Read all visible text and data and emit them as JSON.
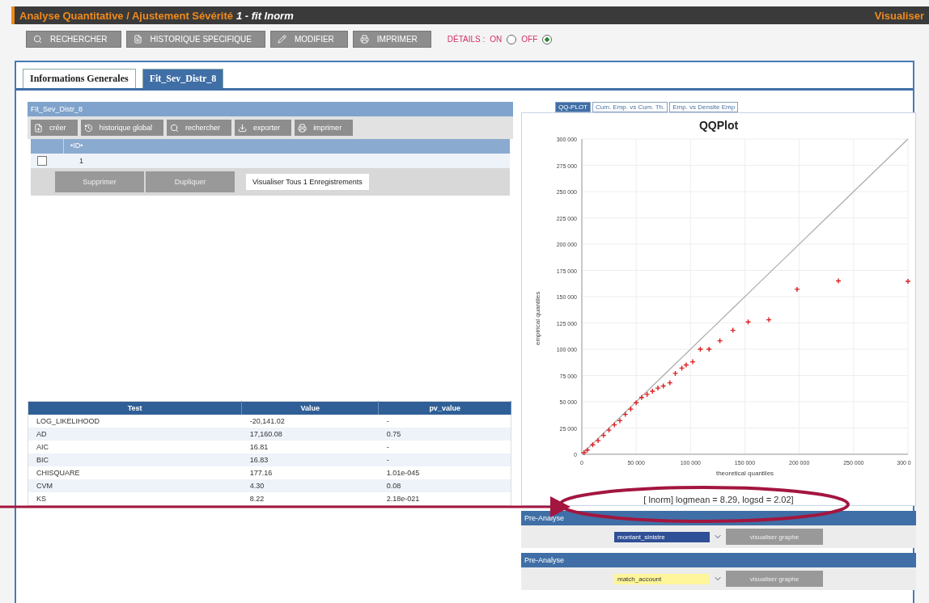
{
  "header": {
    "title": "Analyse Quantitative / Ajustement Sévérité",
    "subtitle": "1 - fit lnorm",
    "action": "Visualiser"
  },
  "toolbar": {
    "buttons": [
      "RECHERCHER",
      "HISTORIQUE SPECIFIQUE",
      "MODIFIER",
      "IMPRIMER"
    ],
    "details_label": "DÉTAILS :",
    "options": [
      {
        "label": "ON",
        "selected": false
      },
      {
        "label": "OFF",
        "selected": true
      }
    ]
  },
  "tabs": [
    {
      "label": "Informations Generales",
      "selected": false
    },
    {
      "label": "Fit_Sev_Distr_8",
      "selected": true
    }
  ],
  "panel": {
    "title": "Fit_Sev_Distr_8",
    "buttons": [
      "créer",
      "historique global",
      "rechercher",
      "exporter",
      "imprimer"
    ],
    "columns": [
      "•ID•"
    ],
    "rows": [
      {
        "checked": false,
        "id": "1"
      }
    ],
    "footer_buttons": [
      "Supprimer",
      "Dupliquer"
    ],
    "count": "Visualiser Tous 1 Enregistrements"
  },
  "stats": {
    "columns": [
      "Test",
      "Value",
      "pv_value"
    ],
    "rows": [
      [
        "LOG_LIKELIHOOD",
        "-20,141.02",
        "-"
      ],
      [
        "AD",
        "17,160.08",
        "0.75"
      ],
      [
        "AIC",
        "16.81",
        "-"
      ],
      [
        "BIC",
        "16.83",
        "-"
      ],
      [
        "CHISQUARE",
        "177.16",
        "1.01e-045"
      ],
      [
        "CVM",
        "4.30",
        "0.08"
      ],
      [
        "KS",
        "8.22",
        "2.18e-021"
      ]
    ]
  },
  "chart_tabs": [
    {
      "label": "QQ-PLOT",
      "selected": true
    },
    {
      "label": "Cum. Emp. vs Cum. Th.",
      "selected": false
    },
    {
      "label": "Emp. vs Densite Emp",
      "selected": false
    }
  ],
  "chart": {
    "chart_data": {
      "type": "scatter",
      "title": "QQPlot",
      "xlabel": "theoretical quantiles",
      "ylabel": "empirical quantiles",
      "x": [
        2000,
        5000,
        10000,
        15000,
        20000,
        25000,
        30000,
        35000,
        40000,
        45000,
        50000,
        55000,
        60000,
        65000,
        70000,
        75000,
        81000,
        86000,
        92000,
        96000,
        102000,
        109000,
        117000,
        127000,
        139000,
        153000,
        172000,
        198000,
        236000,
        300000
      ],
      "grid": true,
      "series": [
        {
          "type": "line",
          "color": "#aaaaaa",
          "values": [
            2000,
            5000,
            10000,
            15000,
            20000,
            25000,
            30000,
            35000,
            40000,
            45000,
            50000,
            55000,
            60000,
            65000,
            70000,
            75000,
            81000,
            86000,
            92000,
            96000,
            102000,
            109000,
            117000,
            127000,
            139000,
            153000,
            172000,
            198000,
            236000,
            300000
          ]
        },
        {
          "color": "#dd2222",
          "values": [
            1500,
            4000,
            9000,
            13000,
            18000,
            23000,
            28000,
            32000,
            38000,
            43000,
            49000,
            54000,
            57000,
            60000,
            63000,
            65000,
            68000,
            77000,
            82000,
            85000,
            88000,
            100000,
            100000,
            108000,
            118000,
            126000,
            128000,
            157000,
            165000,
            164600
          ]
        }
      ],
      "xlim": [
        0,
        300000
      ],
      "ylim": [
        0,
        300000
      ],
      "xticks": [
        0,
        {
          "value": 50000,
          "label": "50 000"
        },
        {
          "value": 100000,
          "label": "100 000"
        },
        {
          "value": 150000,
          "label": "150 000"
        },
        {
          "value": 200000,
          "label": "200 000"
        },
        {
          "value": 250000,
          "label": "250 000"
        },
        {
          "value": 300000,
          "label": "300 0"
        }
      ],
      "yticks": [
        0,
        {
          "value": 25000,
          "label": "25 000"
        },
        {
          "value": 50000,
          "label": "50 000"
        },
        {
          "value": 75000,
          "label": "75 000"
        },
        {
          "value": 100000,
          "label": "100 000"
        },
        {
          "value": 125000,
          "label": "125 000"
        },
        {
          "value": 150000,
          "label": "150 000"
        },
        {
          "value": 175000,
          "label": "175 000"
        },
        {
          "value": 200000,
          "label": "200 000"
        },
        {
          "value": 225000,
          "label": "225 000"
        },
        {
          "value": 250000,
          "label": "250 000"
        },
        {
          "value": 275000,
          "label": "275 000"
        },
        {
          "value": 300000,
          "label": "300 000"
        }
      ]
    },
    "caption": "[ lnorm] logmean = 8.29, logsd = 2.02]"
  },
  "pre_analyses": [
    {
      "title": "Pre-Analyse",
      "select": "montant_sinistre",
      "highlighted": true,
      "button": "visualiser graphe"
    },
    {
      "title": "Pre-Analyse",
      "select": "match_account",
      "highlighted": false,
      "button": "visualiser graphe"
    }
  ]
}
